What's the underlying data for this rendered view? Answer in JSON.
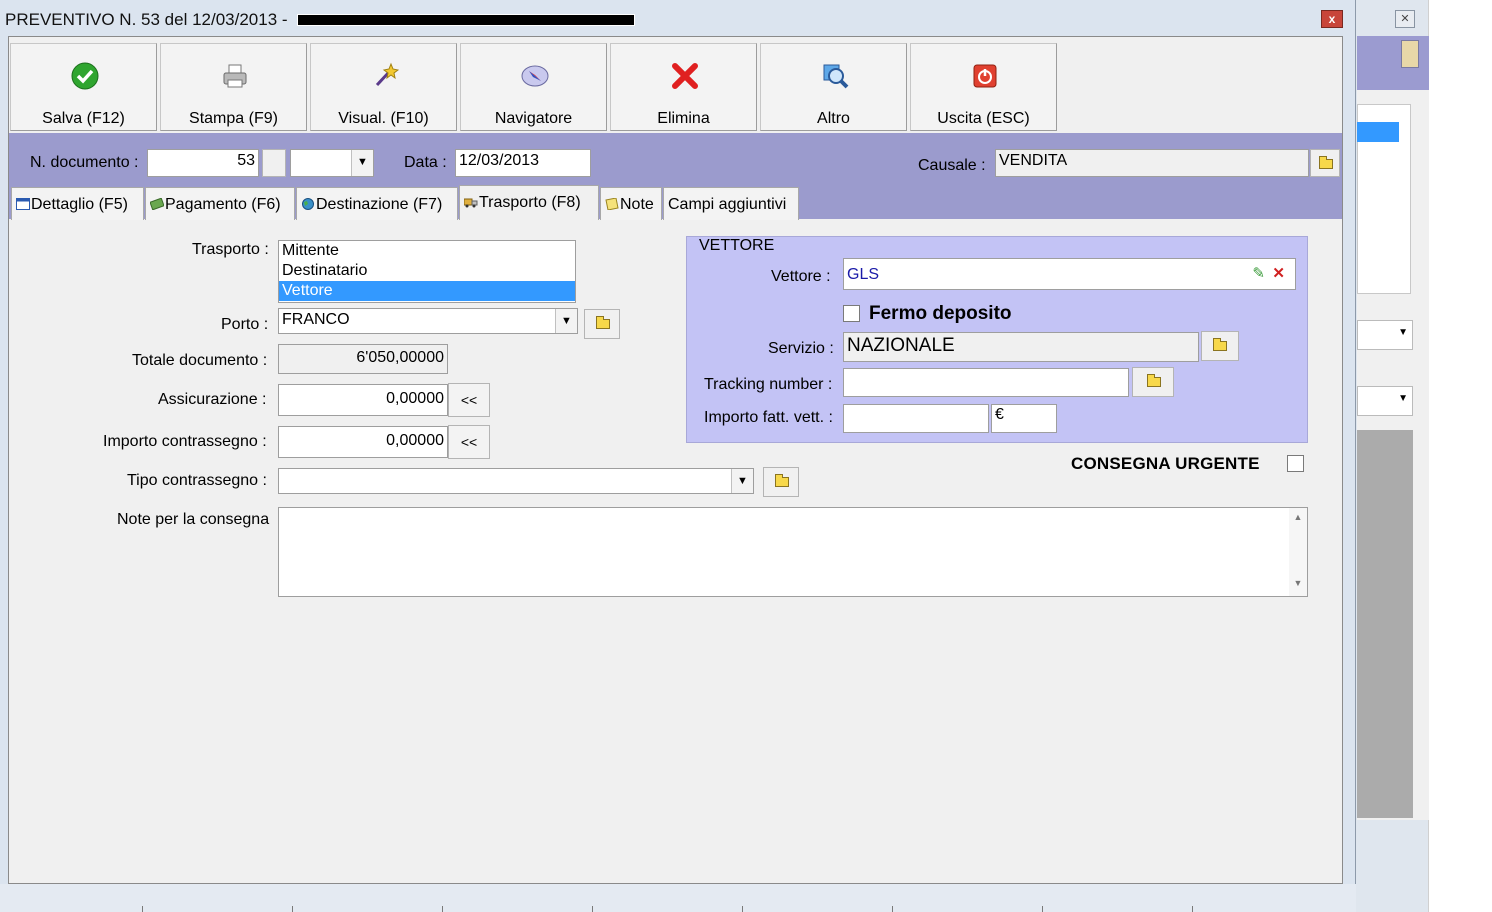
{
  "window": {
    "title": "PREVENTIVO N. 53 del 12/03/2013 -",
    "close_label": "x"
  },
  "toolbar": {
    "buttons": [
      {
        "label": "Salva (F12)",
        "icon": "check-icon",
        "color": "#2fa52f"
      },
      {
        "label": "Stampa (F9)",
        "icon": "printer-icon",
        "color": "#8a8a8a"
      },
      {
        "label": "Visual. (F10)",
        "icon": "magic-wand-icon",
        "color": "#d8b030"
      },
      {
        "label": "Navigatore",
        "icon": "compass-icon",
        "color": "#7070c0"
      },
      {
        "label": "Elimina",
        "icon": "red-x-icon",
        "color": "#e02020"
      },
      {
        "label": "Altro",
        "icon": "magnifier-icon",
        "color": "#3a80d0"
      },
      {
        "label": "Uscita (ESC)",
        "icon": "power-icon",
        "color": "#e04030"
      }
    ]
  },
  "header": {
    "doc_number_label": "N. documento :",
    "doc_number_value": "53",
    "date_label": "Data :",
    "date_value": "12/03/2013",
    "causale_label": "Causale :",
    "causale_value": "VENDITA"
  },
  "tabs": [
    {
      "label": "Dettaglio (F5)",
      "icon": "table-icon",
      "active": false
    },
    {
      "label": "Pagamento (F6)",
      "icon": "money-icon",
      "active": false
    },
    {
      "label": "Destinazione (F7)",
      "icon": "globe-icon",
      "active": false
    },
    {
      "label": "Trasporto (F8)",
      "icon": "truck-icon",
      "active": true
    },
    {
      "label": "Note",
      "icon": "note-icon",
      "active": false
    },
    {
      "label": "Campi aggiuntivi",
      "icon": "",
      "active": false
    }
  ],
  "trasporto": {
    "label": "Trasporto :",
    "options": [
      "Mittente",
      "Destinatario",
      "Vettore"
    ],
    "selected": "Vettore"
  },
  "porto": {
    "label": "Porto :",
    "value": "FRANCO"
  },
  "totale": {
    "label": "Totale documento :",
    "value": "6'050,00000"
  },
  "assicurazione": {
    "label": "Assicurazione :",
    "value": "0,00000",
    "button": "<<"
  },
  "contrassegno": {
    "label": "Importo contrassegno :",
    "value": "0,00000",
    "button": "<<"
  },
  "tipo_contrassegno": {
    "label": "Tipo contrassegno :",
    "value": ""
  },
  "note_consegna": {
    "label": "Note per la consegna",
    "value": ""
  },
  "vettore_group": {
    "title": "VETTORE",
    "vettore_label": "Vettore :",
    "vettore_value": "GLS",
    "fermo_label": "Fermo deposito",
    "fermo_checked": false,
    "servizio_label": "Servizio :",
    "servizio_value": "NAZIONALE",
    "tracking_label": "Tracking number :",
    "tracking_value": "",
    "importo_label": "Importo fatt. vett. :",
    "importo_value": "",
    "currency": "€"
  },
  "urgente": {
    "label": "CONSEGNA URGENTE",
    "checked": false
  },
  "colors": {
    "band": "#9b9bcd",
    "vettore_box": "#c3c3f5",
    "selection": "#3399ff"
  }
}
